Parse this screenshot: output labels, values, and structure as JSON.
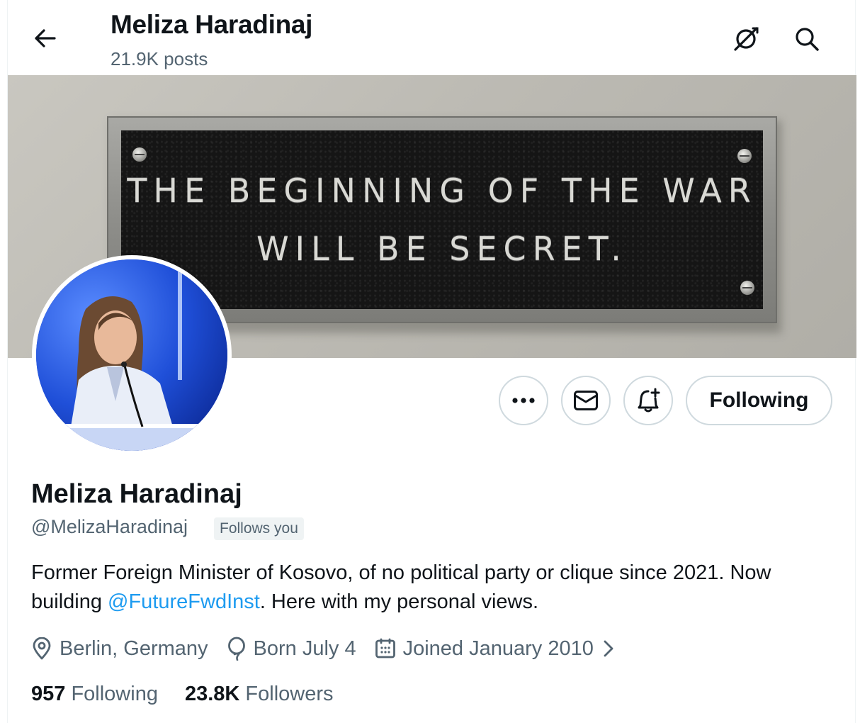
{
  "header": {
    "name": "Meliza Haradinaj",
    "posts": "21.9K posts"
  },
  "icons": {
    "back": "arrow-left-icon",
    "grok": "grok-icon",
    "search": "search-icon",
    "more": "more-horizontal-icon",
    "message": "envelope-icon",
    "notify": "bell-plus-icon",
    "location": "location-pin-icon",
    "birthday": "balloon-icon",
    "joined": "calendar-icon",
    "chevron": "chevron-right-icon"
  },
  "banner": {
    "plaque_line1": "THE BEGINNING OF THE WAR",
    "plaque_line2": "WILL BE SECRET."
  },
  "actions": {
    "following_label": "Following"
  },
  "profile": {
    "name": "Meliza Haradinaj",
    "handle": "@MelizaHaradinaj",
    "follows_you": "Follows you",
    "bio_part1": "Former Foreign Minister of Kosovo, of no political party or clique since 2021. Now building ",
    "bio_link": "@FutureFwdInst",
    "bio_part2": ". Here with my personal views.",
    "location": "Berlin, Germany",
    "birthday": "Born July 4",
    "joined": "Joined January 2010",
    "following_count": "957",
    "following_label": "Following",
    "followers_count": "23.8K",
    "followers_label": "Followers"
  },
  "colors": {
    "accent": "#1d9bf0",
    "text": "#0f1419",
    "secondary": "#536471",
    "border": "#cfd9de"
  }
}
